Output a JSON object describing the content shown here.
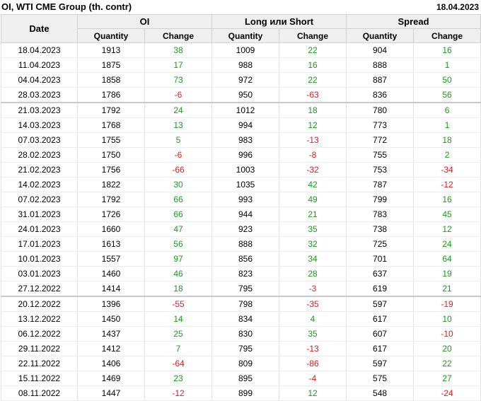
{
  "header": {
    "title": "OI, WTI CME Group (th. contr)",
    "date": "18.04.2023"
  },
  "columns": {
    "date": "Date",
    "group_oi": "OI",
    "group_ls": "Long или Short",
    "group_spread": "Spread",
    "quantity": "Quantity",
    "change": "Change"
  },
  "colors": {
    "positive": "#1a9a1a",
    "negative": "#d42020",
    "header_bg": "#efefef"
  },
  "rows": [
    {
      "date": "18.04.2023",
      "oi_q": "1913",
      "oi_c": "38",
      "ls_q": "1009",
      "ls_c": "22",
      "sp_q": "904",
      "sp_c": "16"
    },
    {
      "date": "11.04.2023",
      "oi_q": "1875",
      "oi_c": "17",
      "ls_q": "988",
      "ls_c": "16",
      "sp_q": "888",
      "sp_c": "1"
    },
    {
      "date": "04.04.2023",
      "oi_q": "1858",
      "oi_c": "73",
      "ls_q": "972",
      "ls_c": "22",
      "sp_q": "887",
      "sp_c": "50"
    },
    {
      "date": "28.03.2023",
      "oi_q": "1786",
      "oi_c": "-6",
      "ls_q": "950",
      "ls_c": "-63",
      "sp_q": "836",
      "sp_c": "56"
    },
    {
      "date": "21.03.2023",
      "oi_q": "1792",
      "oi_c": "24",
      "ls_q": "1012",
      "ls_c": "18",
      "sp_q": "780",
      "sp_c": "6"
    },
    {
      "date": "14.03.2023",
      "oi_q": "1768",
      "oi_c": "13",
      "ls_q": "994",
      "ls_c": "12",
      "sp_q": "773",
      "sp_c": "1"
    },
    {
      "date": "07.03.2023",
      "oi_q": "1755",
      "oi_c": "5",
      "ls_q": "983",
      "ls_c": "-13",
      "sp_q": "772",
      "sp_c": "18"
    },
    {
      "date": "28.02.2023",
      "oi_q": "1750",
      "oi_c": "-6",
      "ls_q": "996",
      "ls_c": "-8",
      "sp_q": "755",
      "sp_c": "2"
    },
    {
      "date": "21.02.2023",
      "oi_q": "1756",
      "oi_c": "-66",
      "ls_q": "1003",
      "ls_c": "-32",
      "sp_q": "753",
      "sp_c": "-34"
    },
    {
      "date": "14.02.2023",
      "oi_q": "1822",
      "oi_c": "30",
      "ls_q": "1035",
      "ls_c": "42",
      "sp_q": "787",
      "sp_c": "-12"
    },
    {
      "date": "07.02.2023",
      "oi_q": "1792",
      "oi_c": "66",
      "ls_q": "993",
      "ls_c": "49",
      "sp_q": "799",
      "sp_c": "16"
    },
    {
      "date": "31.01.2023",
      "oi_q": "1726",
      "oi_c": "66",
      "ls_q": "944",
      "ls_c": "21",
      "sp_q": "783",
      "sp_c": "45"
    },
    {
      "date": "24.01.2023",
      "oi_q": "1660",
      "oi_c": "47",
      "ls_q": "923",
      "ls_c": "35",
      "sp_q": "738",
      "sp_c": "12"
    },
    {
      "date": "17.01.2023",
      "oi_q": "1613",
      "oi_c": "56",
      "ls_q": "888",
      "ls_c": "32",
      "sp_q": "725",
      "sp_c": "24"
    },
    {
      "date": "10.01.2023",
      "oi_q": "1557",
      "oi_c": "97",
      "ls_q": "856",
      "ls_c": "34",
      "sp_q": "701",
      "sp_c": "64"
    },
    {
      "date": "03.01.2023",
      "oi_q": "1460",
      "oi_c": "46",
      "ls_q": "823",
      "ls_c": "28",
      "sp_q": "637",
      "sp_c": "19"
    },
    {
      "date": "27.12.2022",
      "oi_q": "1414",
      "oi_c": "18",
      "ls_q": "795",
      "ls_c": "-3",
      "sp_q": "619",
      "sp_c": "21"
    },
    {
      "date": "20.12.2022",
      "oi_q": "1396",
      "oi_c": "-55",
      "ls_q": "798",
      "ls_c": "-35",
      "sp_q": "597",
      "sp_c": "-19"
    },
    {
      "date": "13.12.2022",
      "oi_q": "1450",
      "oi_c": "14",
      "ls_q": "834",
      "ls_c": "4",
      "sp_q": "617",
      "sp_c": "10"
    },
    {
      "date": "06.12.2022",
      "oi_q": "1437",
      "oi_c": "25",
      "ls_q": "830",
      "ls_c": "35",
      "sp_q": "607",
      "sp_c": "-10"
    },
    {
      "date": "29.11.2022",
      "oi_q": "1412",
      "oi_c": "7",
      "ls_q": "795",
      "ls_c": "-13",
      "sp_q": "617",
      "sp_c": "20"
    },
    {
      "date": "22.11.2022",
      "oi_q": "1406",
      "oi_c": "-64",
      "ls_q": "809",
      "ls_c": "-86",
      "sp_q": "597",
      "sp_c": "22"
    },
    {
      "date": "15.11.2022",
      "oi_q": "1469",
      "oi_c": "23",
      "ls_q": "895",
      "ls_c": "-4",
      "sp_q": "575",
      "sp_c": "27"
    },
    {
      "date": "08.11.2022",
      "oi_q": "1447",
      "oi_c": "-12",
      "ls_q": "899",
      "ls_c": "12",
      "sp_q": "548",
      "sp_c": "-24"
    }
  ]
}
